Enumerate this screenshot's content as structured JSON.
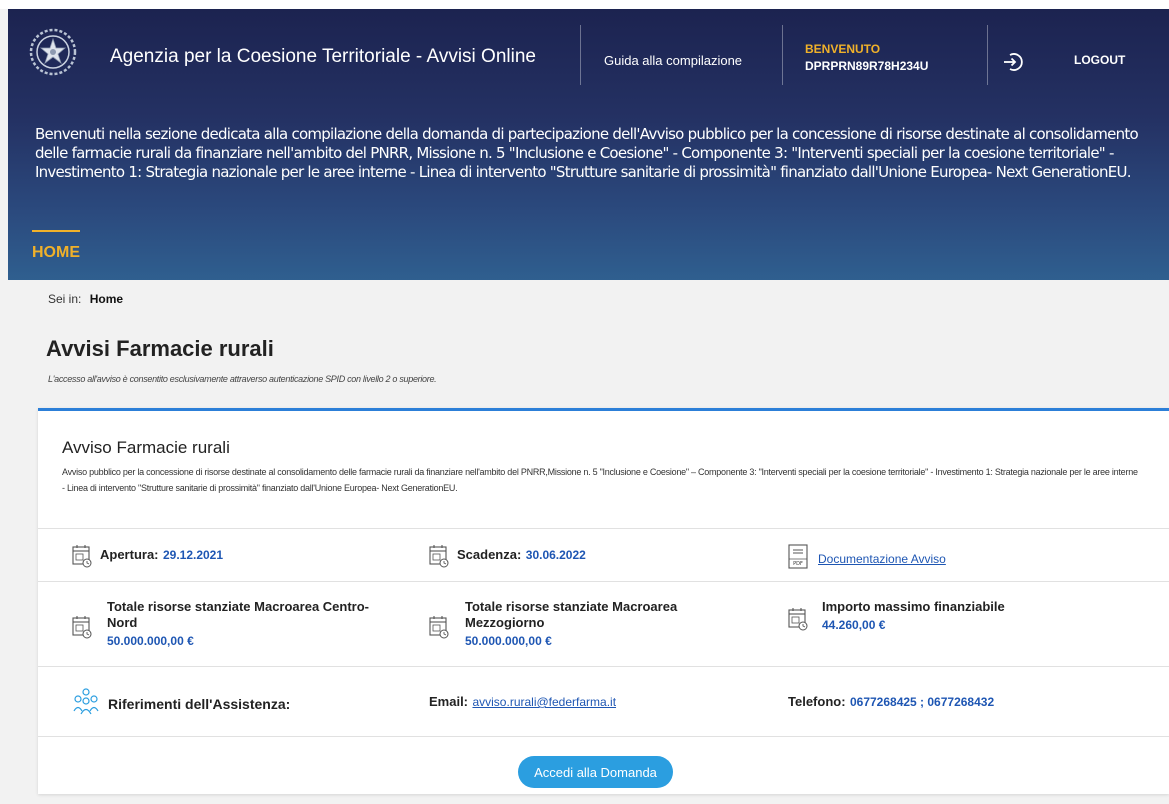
{
  "header": {
    "app_title": "Agenzia per la Coesione Territoriale - Avvisi Online",
    "guide_link": "Guida alla compilazione",
    "welcome_label": "BENVENUTO",
    "user_code": "DPRPRN89R78H234U",
    "logout_label": "LOGOUT",
    "intro_text": "Benvenuti nella sezione dedicata alla compilazione della domanda di partecipazione dell'Avviso pubblico per la concessione di risorse destinate al consolidamento delle farmacie rurali da finanziare nell'ambito del PNRR, Missione n. 5 \"Inclusione e Coesione\" - Componente 3: \"Interventi speciali per la coesione territoriale\" - Investimento 1: Strategia nazionale per le aree interne - Linea di intervento \"Strutture sanitarie di prossimità\" finanziato dall'Unione Europea- Next GenerationEU.",
    "nav_home": "HOME"
  },
  "breadcrumb": {
    "prefix": "Sei in:",
    "current": "Home"
  },
  "page": {
    "title_prefix": "Avvisi",
    "title_bold": "Farmacie rurali",
    "note": "L'accesso all'avviso è consentito esclusivamente attraverso autenticazione SPID con livello 2 o superiore."
  },
  "card": {
    "title": "Avviso Farmacie rurali",
    "description": "Avviso pubblico per la concessione di risorse destinate al consolidamento delle farmacie rurali da finanziare nell'ambito del PNRR,Missione n. 5 \"Inclusione e Coesione\" – Componente 3: \"Interventi speciali per la coesione territoriale\" - Investimento 1: Strategia nazionale per le aree interne - Linea di intervento \"Strutture sanitarie di prossimità\" finanziato dall'Unione Europea- Next GenerationEU.",
    "opening_label": "Apertura:",
    "opening_date": "29.12.2021",
    "deadline_label": "Scadenza:",
    "deadline_date": "30.06.2022",
    "docs_link": "Documentazione Avviso",
    "centro_label": "Totale risorse stanziate Macroarea Centro-Nord",
    "centro_value": "50.000.000,00 €",
    "mezzo_label": "Totale risorse stanziate Macroarea Mezzogiorno",
    "mezzo_value": "50.000.000,00 €",
    "max_label": "Importo massimo finanziabile",
    "max_value": "44.260,00 €",
    "assist_label": "Riferimenti dell'Assistenza:",
    "email_label": "Email:",
    "email_value": "avviso.rurali@federfarma.it",
    "phone_label": "Telefono:",
    "phone_value": "0677268425 ; 0677268432",
    "cta": "Accedi alla Domanda"
  },
  "icons": {
    "emblem": "italian-republic-emblem-icon",
    "logout": "logout-icon",
    "calendar": "calendar-clock-icon",
    "pdf": "pdf-document-icon",
    "assistance": "people-group-icon"
  },
  "colors": {
    "header_dark": "#1c2350",
    "header_light": "#2f5f8f",
    "accent_gold": "#f0b12a",
    "link_blue": "#1e56b3",
    "card_border": "#2c7fd8",
    "button_blue": "#2b9ee0"
  }
}
